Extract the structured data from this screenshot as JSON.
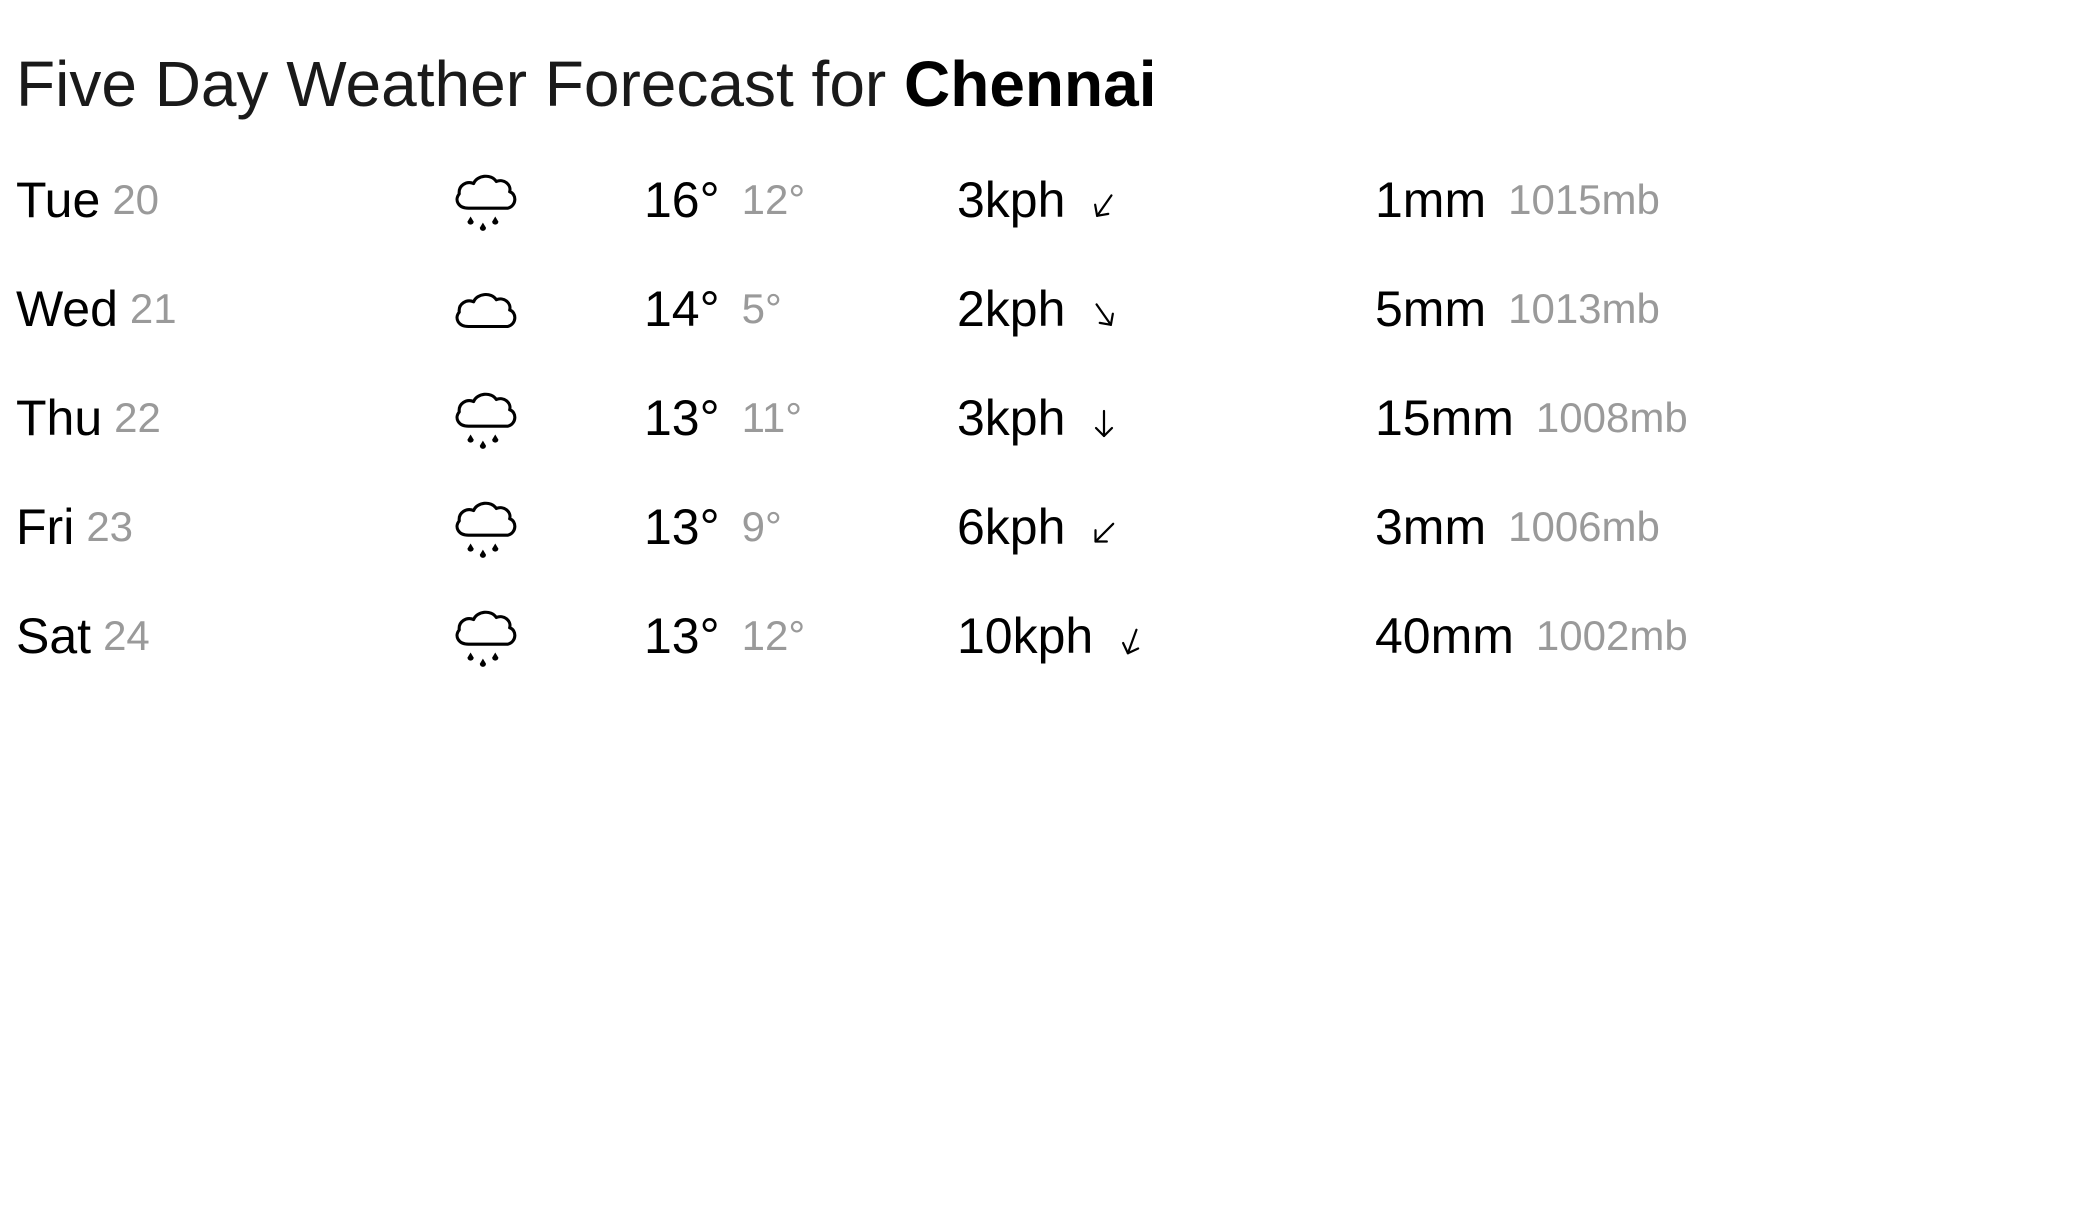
{
  "title": {
    "prefix": "Five Day Weather Forecast for",
    "city": "Chennai"
  },
  "forecast": [
    {
      "day": "Tue",
      "date": "20",
      "icon": "rain-cloud-icon",
      "high": "16°",
      "low": "12°",
      "wind": "3kph",
      "wind_arrow": "southwest-arrow-icon",
      "wind_rotation_deg": 35,
      "precip": "1mm",
      "pressure": "1015mb"
    },
    {
      "day": "Wed",
      "date": "21",
      "icon": "cloud-icon",
      "high": "14°",
      "low": "5°",
      "wind": "2kph",
      "wind_arrow": "southeast-arrow-icon",
      "wind_rotation_deg": -35,
      "precip": "5mm",
      "pressure": "1013mb"
    },
    {
      "day": "Thu",
      "date": "22",
      "icon": "rain-cloud-icon",
      "high": "13°",
      "low": "11°",
      "wind": "3kph",
      "wind_arrow": "south-arrow-icon",
      "wind_rotation_deg": 0,
      "precip": "15mm",
      "pressure": "1008mb"
    },
    {
      "day": "Fri",
      "date": "23",
      "icon": "rain-cloud-icon",
      "high": "13°",
      "low": "9°",
      "wind": "6kph",
      "wind_arrow": "southwest-arrow-icon",
      "wind_rotation_deg": 45,
      "precip": "3mm",
      "pressure": "1006mb"
    },
    {
      "day": "Sat",
      "date": "24",
      "icon": "rain-cloud-icon",
      "high": "13°",
      "low": "12°",
      "wind": "10kph",
      "wind_arrow": "south-southwest-arrow-icon",
      "wind_rotation_deg": 20,
      "precip": "40mm",
      "pressure": "1002mb"
    }
  ]
}
